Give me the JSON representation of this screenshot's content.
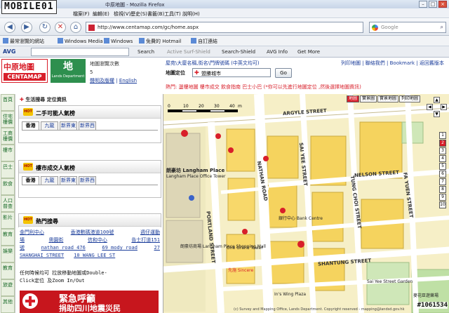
{
  "browser": {
    "watermark_logo": "MOBILE01",
    "window_title": "中原地圖 - Mozilla Firefox",
    "menu": [
      "檔案(F)",
      "編輯(E)",
      "檢視(V)",
      "歷史(S)",
      "書籤(B)",
      "工具(T)",
      "說明(H)"
    ],
    "url": "http://www.centamap.com/gc/home.aspx",
    "search_placeholder": "Google",
    "bookmarks": [
      "最常瀏覽的網站",
      "Windows Media",
      "Windows",
      "免費的 Hotmail",
      "自訂連結"
    ],
    "avg": {
      "logo": "AVG",
      "items": [
        "Search",
        "Active Surf-Shield",
        "Search-Shield",
        "AVG Info",
        "Get More"
      ]
    }
  },
  "site": {
    "logo_cn": "中原地圖",
    "logo_en": "CENTAMAP",
    "lands_logo_glyph": "地",
    "lands_logo_text": "Lands Department",
    "header_links": [
      "地圖瀏覽次數",
      "5",
      "聲明及版權",
      "English"
    ],
    "header_mid": "屋苑\\大廈名稱,街名\\門牌號碼 (中英文均可)",
    "header_right": "列印地圖 | 聯絡我們 | Bookmark | 返回舊版本",
    "location_label": "地圖定位",
    "location_value": "盟勝城市",
    "go_label": "Go",
    "notice": "熱門: 盪樓地圖  樓市成交  飲食指南  巴士小巴 (*你可以先進行地圖定位 ,然後選擇地圖資訊)",
    "leftnav": [
      "首頁",
      "住宅樓價",
      "工商樓價",
      "樓市",
      "巴士",
      "飲食",
      "人口普查",
      "影片",
      "教育",
      "娛樂",
      "教育",
      "旅遊",
      "其他"
    ],
    "section_head": "生活搜尋  定位資訊",
    "panel1": {
      "title": "二手可能人氣榜",
      "badge": "HOT",
      "tabs": [
        "香港",
        "九龍",
        "新界東",
        "新界西"
      ]
    },
    "panel2": {
      "title": "樓市成交人氣榜",
      "badge": "HOT",
      "tabs": [
        "香港",
        "九龍",
        "新界東",
        "新界西"
      ]
    },
    "panel3": {
      "title": "熱門搜尋",
      "badge": "HOT"
    },
    "hot_rows": [
      [
        "金門利中心",
        "香港數碼港道100號",
        "週仔運動"
      ],
      [
        "場",
        "奧園街",
        "信和中心",
        "告士打道151"
      ],
      [
        "號",
        "nathan road 476",
        "69 mody road",
        "27"
      ],
      [
        "SHANGHAI STREET",
        "10 WANG LEE ST"
      ]
    ],
    "tip_line1": "任何時候均可 拉放移動地圖或Double-",
    "tip_line2": "Click定位 及Zoom In/Out",
    "appeal_line1": "緊急呼籲",
    "appeal_line2": "捐助四川地震災民"
  },
  "map": {
    "tabs": [
      "地圖",
      "實景圖",
      "實景地圖",
      "列印地圖"
    ],
    "active_tab": "地圖",
    "zoom_levels": [
      "1",
      "2",
      "3",
      "4",
      "5",
      "6",
      "7",
      "8",
      "9",
      "10"
    ],
    "selected_zoom": "2",
    "scale_ticks": [
      "0",
      "10",
      "20",
      "30",
      "40"
    ],
    "scale_unit": "m",
    "labels": {
      "argyle": "ARGYLE STREET",
      "nathan": "NATHAN ROAD",
      "portland": "PORTLAND STREET",
      "shantung": "SHANTUNG STREET",
      "nelson": "NELSON STREET",
      "tung_choi": "TUNG CHOI STREET",
      "fa_yuen": "FA YUEN STREET",
      "sai_yee": "SAI YEE STREET",
      "langham": "朗豪坊 Langham Place",
      "langham_office": "Langham Place Office Tower",
      "langham_mall": "朗豪坊商場 Langham Place Shopping Mall",
      "one_grand": "One Grand Tower",
      "sincere": "先施 Sincere",
      "bank_centre": "銀行中心 Bank Centre",
      "kings_wing": "In's Wing Plaza",
      "playground": "麥花臣遊樂場",
      "cinema": "Sai Yee Street Garden",
      "copyright": "(c) Survey and Mapping Office, Lands Department. Copyright reserved - mapping@landsd.gov.hk",
      "watermark_id": "#1061534"
    }
  }
}
